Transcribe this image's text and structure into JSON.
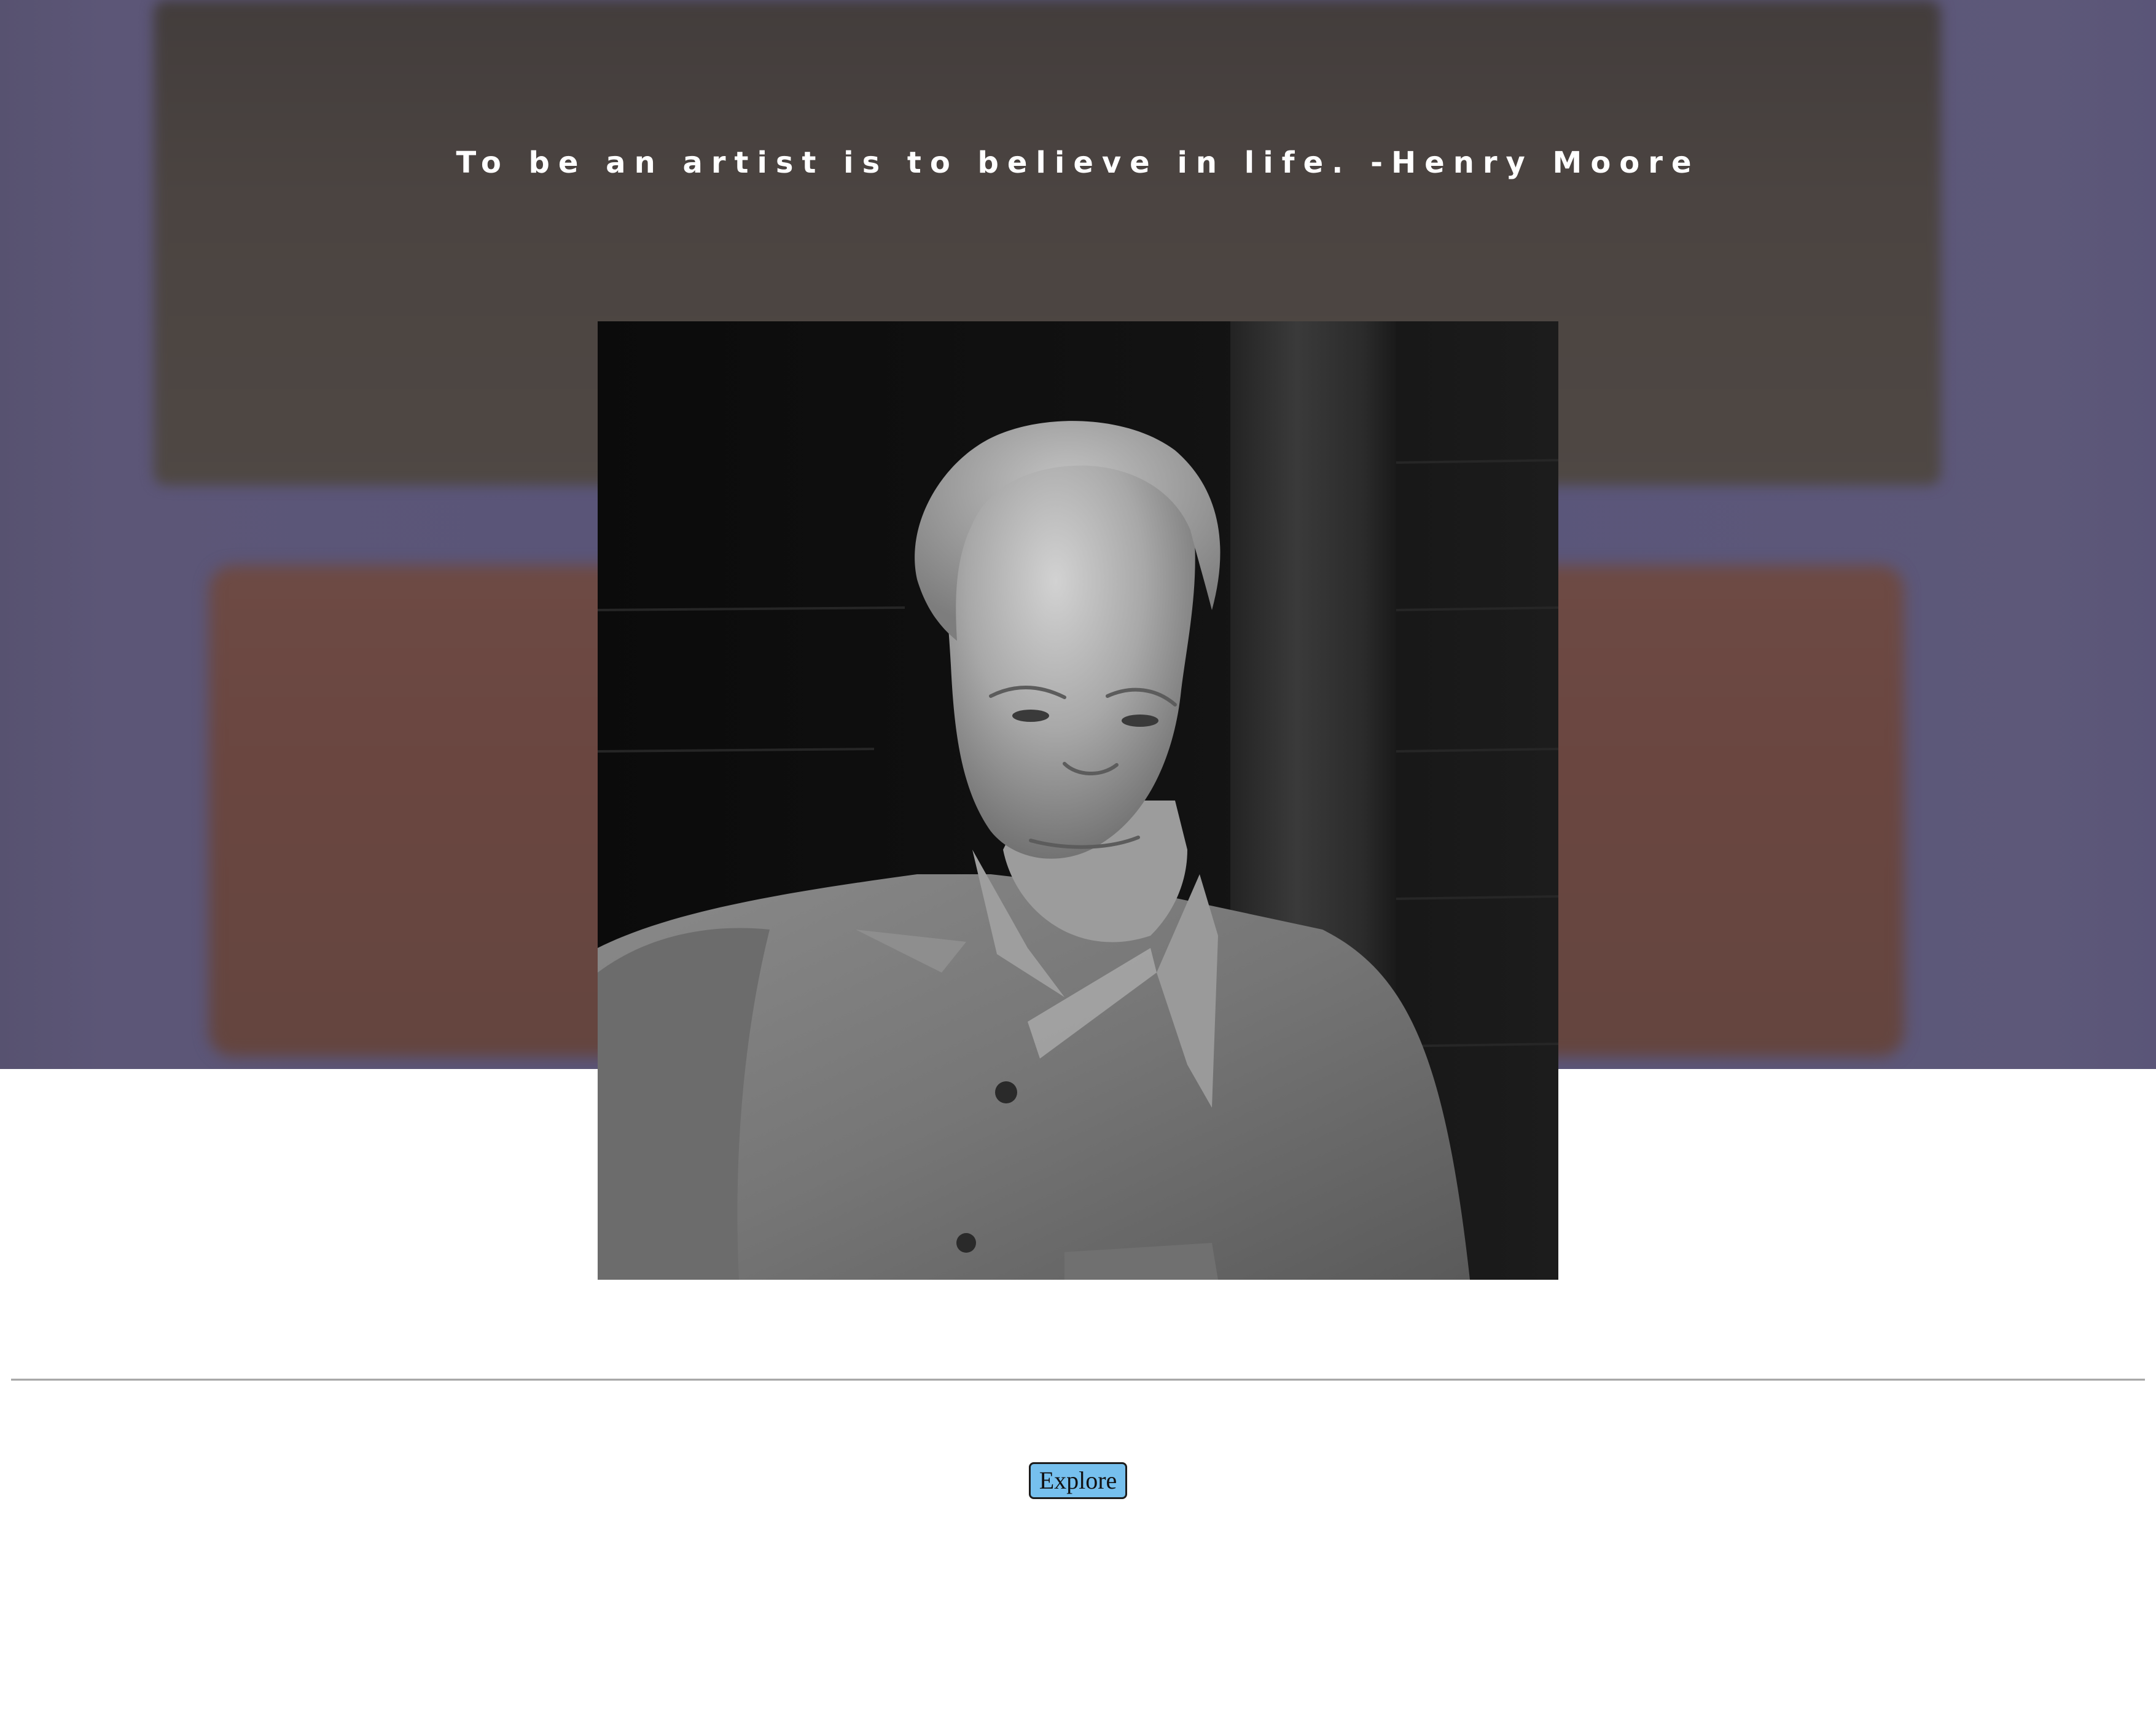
{
  "hero": {
    "quote": "To be an artist is to believe in life. -Henry Moore",
    "background_colors": {
      "field": "#58547a",
      "upper_block": "#4b4441",
      "lower_block": "#6a4640"
    }
  },
  "portrait": {
    "alt": "Black and white portrait of Henry Moore",
    "style": "grayscale photograph"
  },
  "actions": {
    "explore_label": "Explore",
    "explore_color": "#76c0ee"
  }
}
